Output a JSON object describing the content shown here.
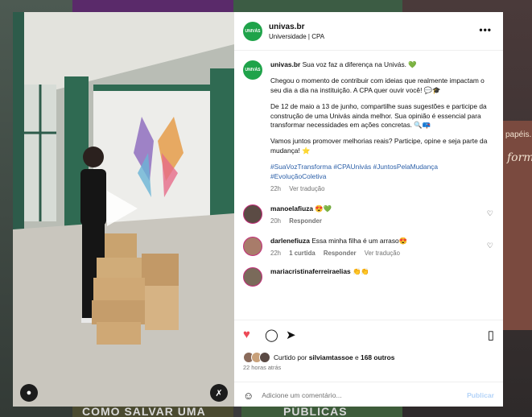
{
  "background": {
    "bottom_left_text": "COMO SALVAR UMA",
    "bottom_right_text": "PÚBLICAS",
    "side_promo_small": "papéis.",
    "side_promo_large": "form"
  },
  "post": {
    "username": "univas.br",
    "subtitle": "Universidade | CPA",
    "avatar_label": "UNIVÁS",
    "more_label": "•••",
    "caption": {
      "username": "univas.br",
      "line1": "Sua voz faz a diferença na Univás. 💚",
      "p2": "Chegou o momento de contribuir com ideias que realmente impactam o seu dia a dia na instituição. A CPA quer ouvir você! 💬🎓",
      "p3": "De 12 de maio a 13 de junho, compartilhe suas sugestões e participe da construção de uma Univás ainda melhor. Sua opinião é essencial para transformar necessidades em ações concretas. 🔍📪",
      "p4": "Vamos juntos promover melhorias reais? Participe, opine e seja parte da mudança! ⭐",
      "hashtags": "#SuaVozTransforma #CPAUnivás #JuntosPelaMudança #EvoluçãoColetiva",
      "time": "22h",
      "translate": "Ver tradução"
    },
    "comments": [
      {
        "username": "manoelafiuza",
        "text": "😍💚",
        "time": "20h",
        "reply": "Responder",
        "avatar_color": "#5b4b44"
      },
      {
        "username": "darlenefiuza",
        "text": "Essa minha filha é um arraso😍",
        "time": "22h",
        "likes": "1 curtida",
        "reply": "Responder",
        "translate": "Ver tradução",
        "avatar_color": "#a87c6a"
      },
      {
        "username": "mariacristinaferreiraelias",
        "text": "👏👏",
        "avatar_color": "#7a6a5a"
      }
    ],
    "liked_by": "Curtido por",
    "liked_user": "silviamtassoe",
    "and_others": "e",
    "others_count": "168 outros",
    "posted_ago": "22 horas atrás",
    "comment_placeholder": "Adicione um comentário...",
    "publish_label": "Publicar",
    "colors": {
      "accent": "#1fa34a",
      "like": "#ed4956",
      "link": "#2b5fa8"
    }
  }
}
